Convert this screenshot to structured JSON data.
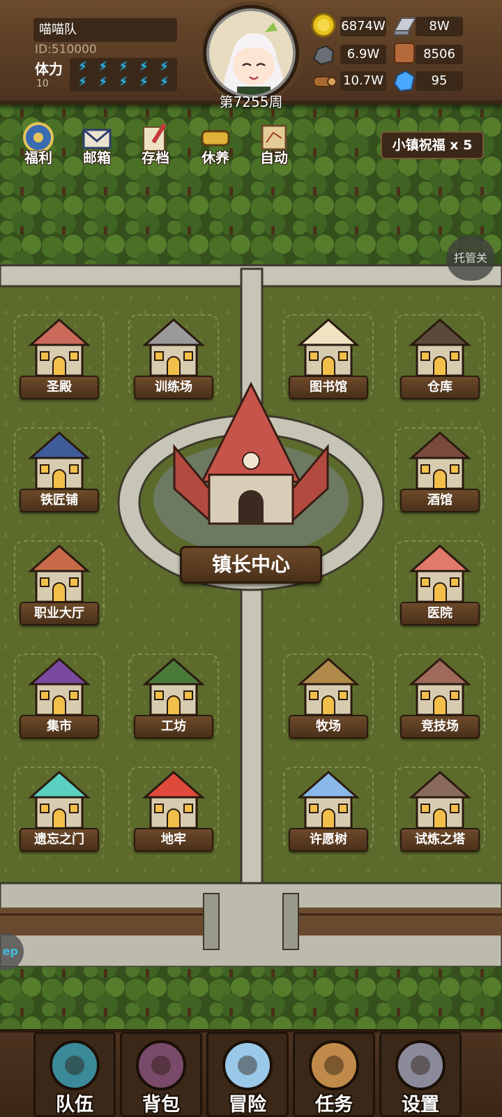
{
  "header": {
    "team_name": "喵喵队",
    "player_id": "ID:510000",
    "stamina_label": "体力",
    "stamina_value": "10",
    "stamina_bolts": 10,
    "week": "第7255周"
  },
  "resources": [
    {
      "icon": "gold-coin-icon",
      "value": "6874W"
    },
    {
      "icon": "iron-ingot-icon",
      "value": "8W"
    },
    {
      "icon": "stone-ore-icon",
      "value": "6.9W"
    },
    {
      "icon": "leather-icon",
      "value": "8506"
    },
    {
      "icon": "wood-log-icon",
      "value": "10.7W"
    },
    {
      "icon": "crystal-icon",
      "value": "95"
    }
  ],
  "menu": [
    {
      "label": "福利",
      "icon": "welfare-shield-icon"
    },
    {
      "label": "邮箱",
      "icon": "mailbox-icon"
    },
    {
      "label": "存档",
      "icon": "save-quill-icon"
    },
    {
      "label": "休养",
      "icon": "rest-scroll-icon"
    },
    {
      "label": "自动",
      "icon": "auto-map-icon"
    }
  ],
  "blessing_label": "小镇祝福 x 5",
  "auto_toggle": "托管关",
  "left_pill": "ep",
  "buildings": [
    {
      "label": "圣殿",
      "icon": "temple-building"
    },
    {
      "label": "训练场",
      "icon": "training-ground-building"
    },
    {
      "label": "图书馆",
      "icon": "library-building"
    },
    {
      "label": "仓库",
      "icon": "warehouse-building"
    },
    {
      "label": "铁匠铺",
      "icon": "blacksmith-building"
    },
    {
      "label": "酒馆",
      "icon": "tavern-building"
    },
    {
      "label": "职业大厅",
      "icon": "class-hall-building"
    },
    {
      "label": "医院",
      "icon": "hospital-building"
    },
    {
      "label": "集市",
      "icon": "market-building"
    },
    {
      "label": "工坊",
      "icon": "workshop-building"
    },
    {
      "label": "牧场",
      "icon": "ranch-building"
    },
    {
      "label": "竞技场",
      "icon": "arena-building"
    },
    {
      "label": "遗忘之门",
      "icon": "forgotten-gate-building"
    },
    {
      "label": "地牢",
      "icon": "dungeon-building"
    },
    {
      "label": "许愿树",
      "icon": "wishing-tree-building"
    },
    {
      "label": "试炼之塔",
      "icon": "trial-tower-building"
    }
  ],
  "town_hall_label": "镇长中心",
  "bottom_nav": [
    {
      "label": "队伍",
      "icon": "team-helmet-icon"
    },
    {
      "label": "背包",
      "icon": "backpack-icon"
    },
    {
      "label": "冒险",
      "icon": "adventure-swords-icon"
    },
    {
      "label": "任务",
      "icon": "quest-scroll-icon"
    },
    {
      "label": "设置",
      "icon": "settings-gear-icon"
    }
  ],
  "colors": {
    "grass": "#5c6b2c",
    "road": "#c7c5b6",
    "forest": "#3d5a22",
    "wood_panel": "#4d3320",
    "stamina": "#32c8ff"
  }
}
